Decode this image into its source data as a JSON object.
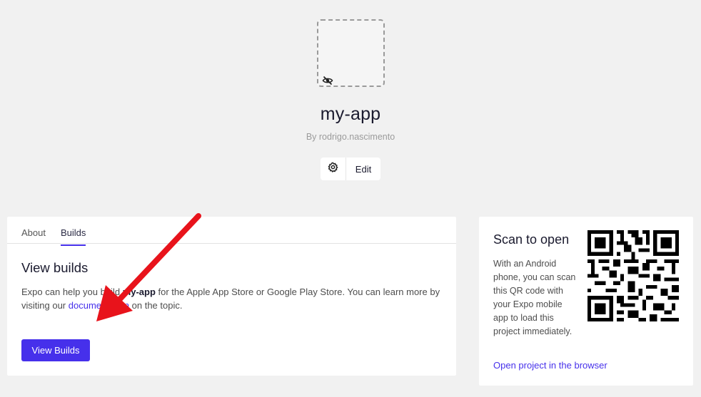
{
  "project": {
    "name": "my-app",
    "owner_line": "By rodrigo.nascimento",
    "icon_state": "eye-off-icon"
  },
  "actions": {
    "settings_icon": "gear-icon",
    "edit_label": "Edit"
  },
  "tabs": [
    {
      "label": "About",
      "active": false
    },
    {
      "label": "Builds",
      "active": true
    }
  ],
  "builds": {
    "title": "View builds",
    "desc_part1": "Expo can help you build ",
    "desc_app": "my-app",
    "desc_part2": " for the Apple App Store or Google Play Store. You can learn more by visiting our ",
    "desc_link": "documentation",
    "desc_part3": " on the topic.",
    "button_label": "View Builds"
  },
  "qr": {
    "title": "Scan to open",
    "text": "With an Android phone, you can scan this QR code with your Expo mobile app to load this project immediately.",
    "link": "Open project in the browser"
  },
  "colors": {
    "accent": "#4630eb",
    "background": "#f1f1f1",
    "annotation_arrow": "#e8131b"
  }
}
